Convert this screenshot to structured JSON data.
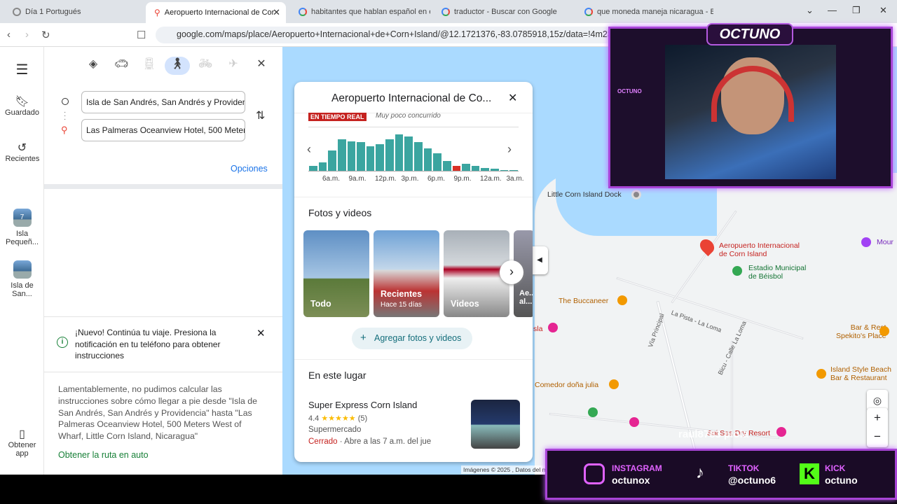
{
  "tabs": [
    {
      "title": "Día 1 Portugués",
      "active": false
    },
    {
      "title": "Aeropuerto Internacional de Cor",
      "active": true
    },
    {
      "title": "habitantes que hablan español en el",
      "active": false
    },
    {
      "title": "traductor - Buscar con Google",
      "active": false
    },
    {
      "title": "que moneda maneja nicaragua - Bus",
      "active": false
    }
  ],
  "address_bar": {
    "url": "google.com/maps/place/Aeropuerto+Internacional+de+Corn+Island/@12.1721376,-83.0785918,15z/data=!4m23!1m1"
  },
  "rail": {
    "saved": "Guardado",
    "recents": "Recientes",
    "recent1": "Isla Pequeñ...",
    "recent1_badge": "7",
    "recent2": "Isla de San...",
    "get_app": "Obtener app"
  },
  "directions": {
    "origin": "Isla de San Andrés, San Andrés y Providencia",
    "destination": "Las Palmeras Oceanview Hotel, 500 Meters West of Wharf, Little Corn Island, Nicaragua",
    "options": "Opciones",
    "notice": "¡Nuevo! Continúa tu viaje. Presiona la notificación en tu teléfono para obtener instrucciones",
    "error": "Lamentablemente, no pudimos calcular las instrucciones sobre cómo llegar a pie desde \"Isla de San Andrés, San Andrés y Providencia\" hasta \"Las Palmeras Oceanview Hotel, 500 Meters West of Wharf, Little Corn Island, Nicaragua\"",
    "car_link": "Obtener la ruta en auto"
  },
  "place": {
    "title": "Aeropuerto Internacional de Co...",
    "live_badge": "EN TIEMPO REAL",
    "live_text": "Muy poco concurrido",
    "popular_times": [
      10,
      16,
      40,
      62,
      58,
      56,
      48,
      52,
      62,
      72,
      68,
      56,
      44,
      34,
      20,
      10,
      14,
      10,
      6,
      4,
      2,
      2
    ],
    "live_index": 15,
    "hour_ticks": [
      "6a.m.",
      "9a.m.",
      "12p.m.",
      "3p.m.",
      "6p.m.",
      "9p.m.",
      "12a.m.",
      "3a.m."
    ],
    "photos_header": "Fotos y videos",
    "photos": [
      {
        "label": "Todo",
        "sub": ""
      },
      {
        "label": "Recientes",
        "sub": "Hace 15 días"
      },
      {
        "label": "Videos",
        "sub": ""
      },
      {
        "label": "Ae... al...",
        "sub": ""
      }
    ],
    "add_photos": "Agregar fotos y videos",
    "here_header": "En este lugar",
    "nearby": {
      "name": "Super Express Corn Island",
      "rating": "4.4",
      "stars": "★★★★★",
      "reviews": "(5)",
      "category": "Supermercado",
      "status": "Cerrado",
      "hours": " · Abre a las 7 a.m. del jue"
    }
  },
  "map_labels": {
    "dock": "Little Corn Island Dock",
    "airport": "Aeropuerto Internacional\nde Corn Island",
    "stadium": "Estadio Municipal\nde Béisbol",
    "buccaneer": "The Buccaneer",
    "pista": "La Pista - La Loma",
    "principal": "Vía Principal",
    "bicu": "Bicu - Calle La Loma",
    "bar_rest": "Bar & Rest\nSpekito's Place",
    "island_style": "Island Style Beach\nBar & Restaurant",
    "comedor": "Comedor doña julia",
    "dry_resort": "Sol Sea Dry Resort",
    "sla": "sla",
    "mour": "Mour",
    "attribution": "Imágenes © 2025 , Datos del m"
  },
  "overlay": {
    "logo": "OCTUNO",
    "instagram_t": "INSTAGRAM",
    "instagram_h": "octunox",
    "tiktok_t": "TIKTOK",
    "tiktok_h": "@octuno6",
    "kick_t": "KICK",
    "kick_h": "octuno",
    "watermark": "raul8783 piola",
    "side_text": "OCTUNO"
  }
}
